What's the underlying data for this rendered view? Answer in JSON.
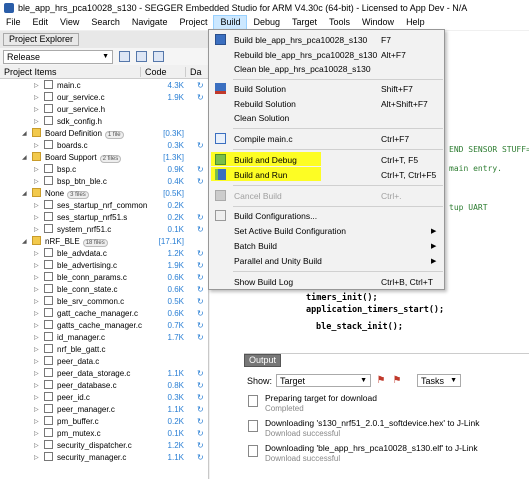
{
  "window": {
    "title": "ble_app_hrs_pca10028_s130 - SEGGER Embedded Studio for ARM V4.30c (64-bit) - Licensed to App Dev - N/A",
    "icon": "segger-app-icon"
  },
  "menubar": [
    "File",
    "Edit",
    "View",
    "Search",
    "Navigate",
    "Project",
    "Build",
    "Debug",
    "Target",
    "Tools",
    "Window",
    "Help"
  ],
  "project_explorer": {
    "tab_label": "Project Explorer",
    "configuration": "Release",
    "columns": {
      "items": "Project Items",
      "code": "Code",
      "data": "Da"
    },
    "rows": [
      {
        "name": "main.c",
        "kind": "file",
        "indent": 3,
        "size": "4.3K",
        "sync": true
      },
      {
        "name": "our_service.c",
        "kind": "file",
        "indent": 3,
        "size": "1.9K",
        "sync": true
      },
      {
        "name": "our_service.h",
        "kind": "file",
        "indent": 3,
        "size": "",
        "sync": false
      },
      {
        "name": "sdk_config.h",
        "kind": "file",
        "indent": 3,
        "size": "",
        "sync": false
      },
      {
        "name": "Board Definition",
        "kind": "folder",
        "indent": 2,
        "badge": "1 file",
        "size": "[0.3K]",
        "sync": false
      },
      {
        "name": "boards.c",
        "kind": "file",
        "indent": 3,
        "size": "0.3K",
        "sync": true
      },
      {
        "name": "Board Support",
        "kind": "folder",
        "indent": 2,
        "badge": "2 files",
        "size": "[1.3K]",
        "sync": false
      },
      {
        "name": "bsp.c",
        "kind": "file",
        "indent": 3,
        "size": "0.9K",
        "sync": true
      },
      {
        "name": "bsp_btn_ble.c",
        "kind": "file",
        "indent": 3,
        "size": "0.4K",
        "sync": true
      },
      {
        "name": "None",
        "kind": "folder",
        "indent": 2,
        "badge": "3 files",
        "size": "[0.5K]",
        "sync": false
      },
      {
        "name": "ses_startup_nrf_common",
        "kind": "file",
        "indent": 3,
        "size": "0.2K",
        "sync": false
      },
      {
        "name": "ses_startup_nrf51.s",
        "kind": "file",
        "indent": 3,
        "size": "0.2K",
        "sync": true
      },
      {
        "name": "system_nrf51.c",
        "kind": "file",
        "indent": 3,
        "size": "0.1K",
        "sync": true
      },
      {
        "name": "nRF_BLE",
        "kind": "folder",
        "indent": 2,
        "badge": "18 files",
        "size": "[17.1K]",
        "sync": false
      },
      {
        "name": "ble_advdata.c",
        "kind": "file",
        "indent": 3,
        "size": "1.2K",
        "sync": true
      },
      {
        "name": "ble_advertising.c",
        "kind": "file",
        "indent": 3,
        "size": "1.9K",
        "sync": true
      },
      {
        "name": "ble_conn_params.c",
        "kind": "file",
        "indent": 3,
        "size": "0.6K",
        "sync": true
      },
      {
        "name": "ble_conn_state.c",
        "kind": "file",
        "indent": 3,
        "size": "0.6K",
        "sync": true
      },
      {
        "name": "ble_srv_common.c",
        "kind": "file",
        "indent": 3,
        "size": "0.5K",
        "sync": true
      },
      {
        "name": "gatt_cache_manager.c",
        "kind": "file",
        "indent": 3,
        "size": "0.6K",
        "sync": true
      },
      {
        "name": "gatts_cache_manager.c",
        "kind": "file",
        "indent": 3,
        "size": "0.7K",
        "sync": true
      },
      {
        "name": "id_manager.c",
        "kind": "file",
        "indent": 3,
        "size": "1.7K",
        "sync": true
      },
      {
        "name": "nrf_ble_gatt.c",
        "kind": "file",
        "indent": 3,
        "size": "",
        "sync": false
      },
      {
        "name": "peer_data.c",
        "kind": "file",
        "indent": 3,
        "size": "",
        "sync": false
      },
      {
        "name": "peer_data_storage.c",
        "kind": "file",
        "indent": 3,
        "size": "1.1K",
        "sync": true
      },
      {
        "name": "peer_database.c",
        "kind": "file",
        "indent": 3,
        "size": "0.8K",
        "sync": true
      },
      {
        "name": "peer_id.c",
        "kind": "file",
        "indent": 3,
        "size": "0.3K",
        "sync": true
      },
      {
        "name": "peer_manager.c",
        "kind": "file",
        "indent": 3,
        "size": "1.1K",
        "sync": true
      },
      {
        "name": "pm_buffer.c",
        "kind": "file",
        "indent": 3,
        "size": "0.2K",
        "sync": true
      },
      {
        "name": "pm_mutex.c",
        "kind": "file",
        "indent": 3,
        "size": "0.1K",
        "sync": true
      },
      {
        "name": "security_dispatcher.c",
        "kind": "file",
        "indent": 3,
        "size": "1.2K",
        "sync": true
      },
      {
        "name": "security_manager.c",
        "kind": "file",
        "indent": 3,
        "size": "1.1K",
        "sync": true
      }
    ]
  },
  "build_menu": {
    "items": [
      {
        "label": "Build ble_app_hrs_pca10028_s130",
        "shortcut": "F7",
        "icon": "build-project-icon",
        "enabled": true
      },
      {
        "label": "Rebuild ble_app_hrs_pca10028_s130",
        "shortcut": "Alt+F7",
        "icon": "",
        "enabled": true
      },
      {
        "label": "Clean ble_app_hrs_pca10028_s130",
        "shortcut": "",
        "icon": "",
        "enabled": true
      },
      {
        "label": "Build Solution",
        "shortcut": "Shift+F7",
        "icon": "build-solution-icon",
        "enabled": true
      },
      {
        "label": "Rebuild Solution",
        "shortcut": "Alt+Shift+F7",
        "icon": "",
        "enabled": true
      },
      {
        "label": "Clean Solution",
        "shortcut": "",
        "icon": "",
        "enabled": true
      },
      {
        "label": "Compile main.c",
        "shortcut": "Ctrl+F7",
        "icon": "compile-icon",
        "enabled": true
      },
      {
        "label": "Build and Debug",
        "shortcut": "Ctrl+T, F5",
        "icon": "build-and-debug-icon",
        "enabled": true,
        "highlighted": true
      },
      {
        "label": "Build and Run",
        "shortcut": "Ctrl+T, Ctrl+F5",
        "icon": "build-and-run-icon",
        "enabled": true,
        "highlighted": true
      },
      {
        "label": "Cancel Build",
        "shortcut": "Ctrl+.",
        "icon": "cancel-build-icon",
        "enabled": false
      },
      {
        "label": "Build Configurations...",
        "shortcut": "",
        "icon": "build-configurations-icon",
        "enabled": true
      },
      {
        "label": "Set Active Build Configuration",
        "shortcut": "",
        "icon": "",
        "enabled": true,
        "submenu": true
      },
      {
        "label": "Batch Build",
        "shortcut": "",
        "icon": "",
        "enabled": true,
        "submenu": true
      },
      {
        "label": "Parallel and Unity Build",
        "shortcut": "",
        "icon": "",
        "enabled": true,
        "submenu": true
      },
      {
        "label": "Show Build Log",
        "shortcut": "Ctrl+B, Ctrl+T",
        "icon": "",
        "enabled": true
      }
    ]
  },
  "editor": {
    "fragments": [
      "END SENSOR STUFF===",
      "main entry.",
      "tup UART"
    ],
    "lines": [
      "timers_init();",
      "application_timers_start();",
      "ble_stack_init();"
    ]
  },
  "output": {
    "tab_label": "Output",
    "show_label": "Show:",
    "show_value": "Target",
    "tasks_label": "Tasks",
    "entries": [
      {
        "message": "Preparing target for download",
        "status": "Completed"
      },
      {
        "message": "Downloading 's130_nrf51_2.0.1_softdevice.hex' to J-Link",
        "status": "Download successful"
      },
      {
        "message": "Downloading 'ble_app_hrs_pca10028_s130.elf' to J-Link",
        "status": "Download successful"
      }
    ]
  },
  "colors": {
    "highlight": "#ffff00",
    "menu_active": "#cce8ff",
    "size_text": "#2a7fd4"
  }
}
